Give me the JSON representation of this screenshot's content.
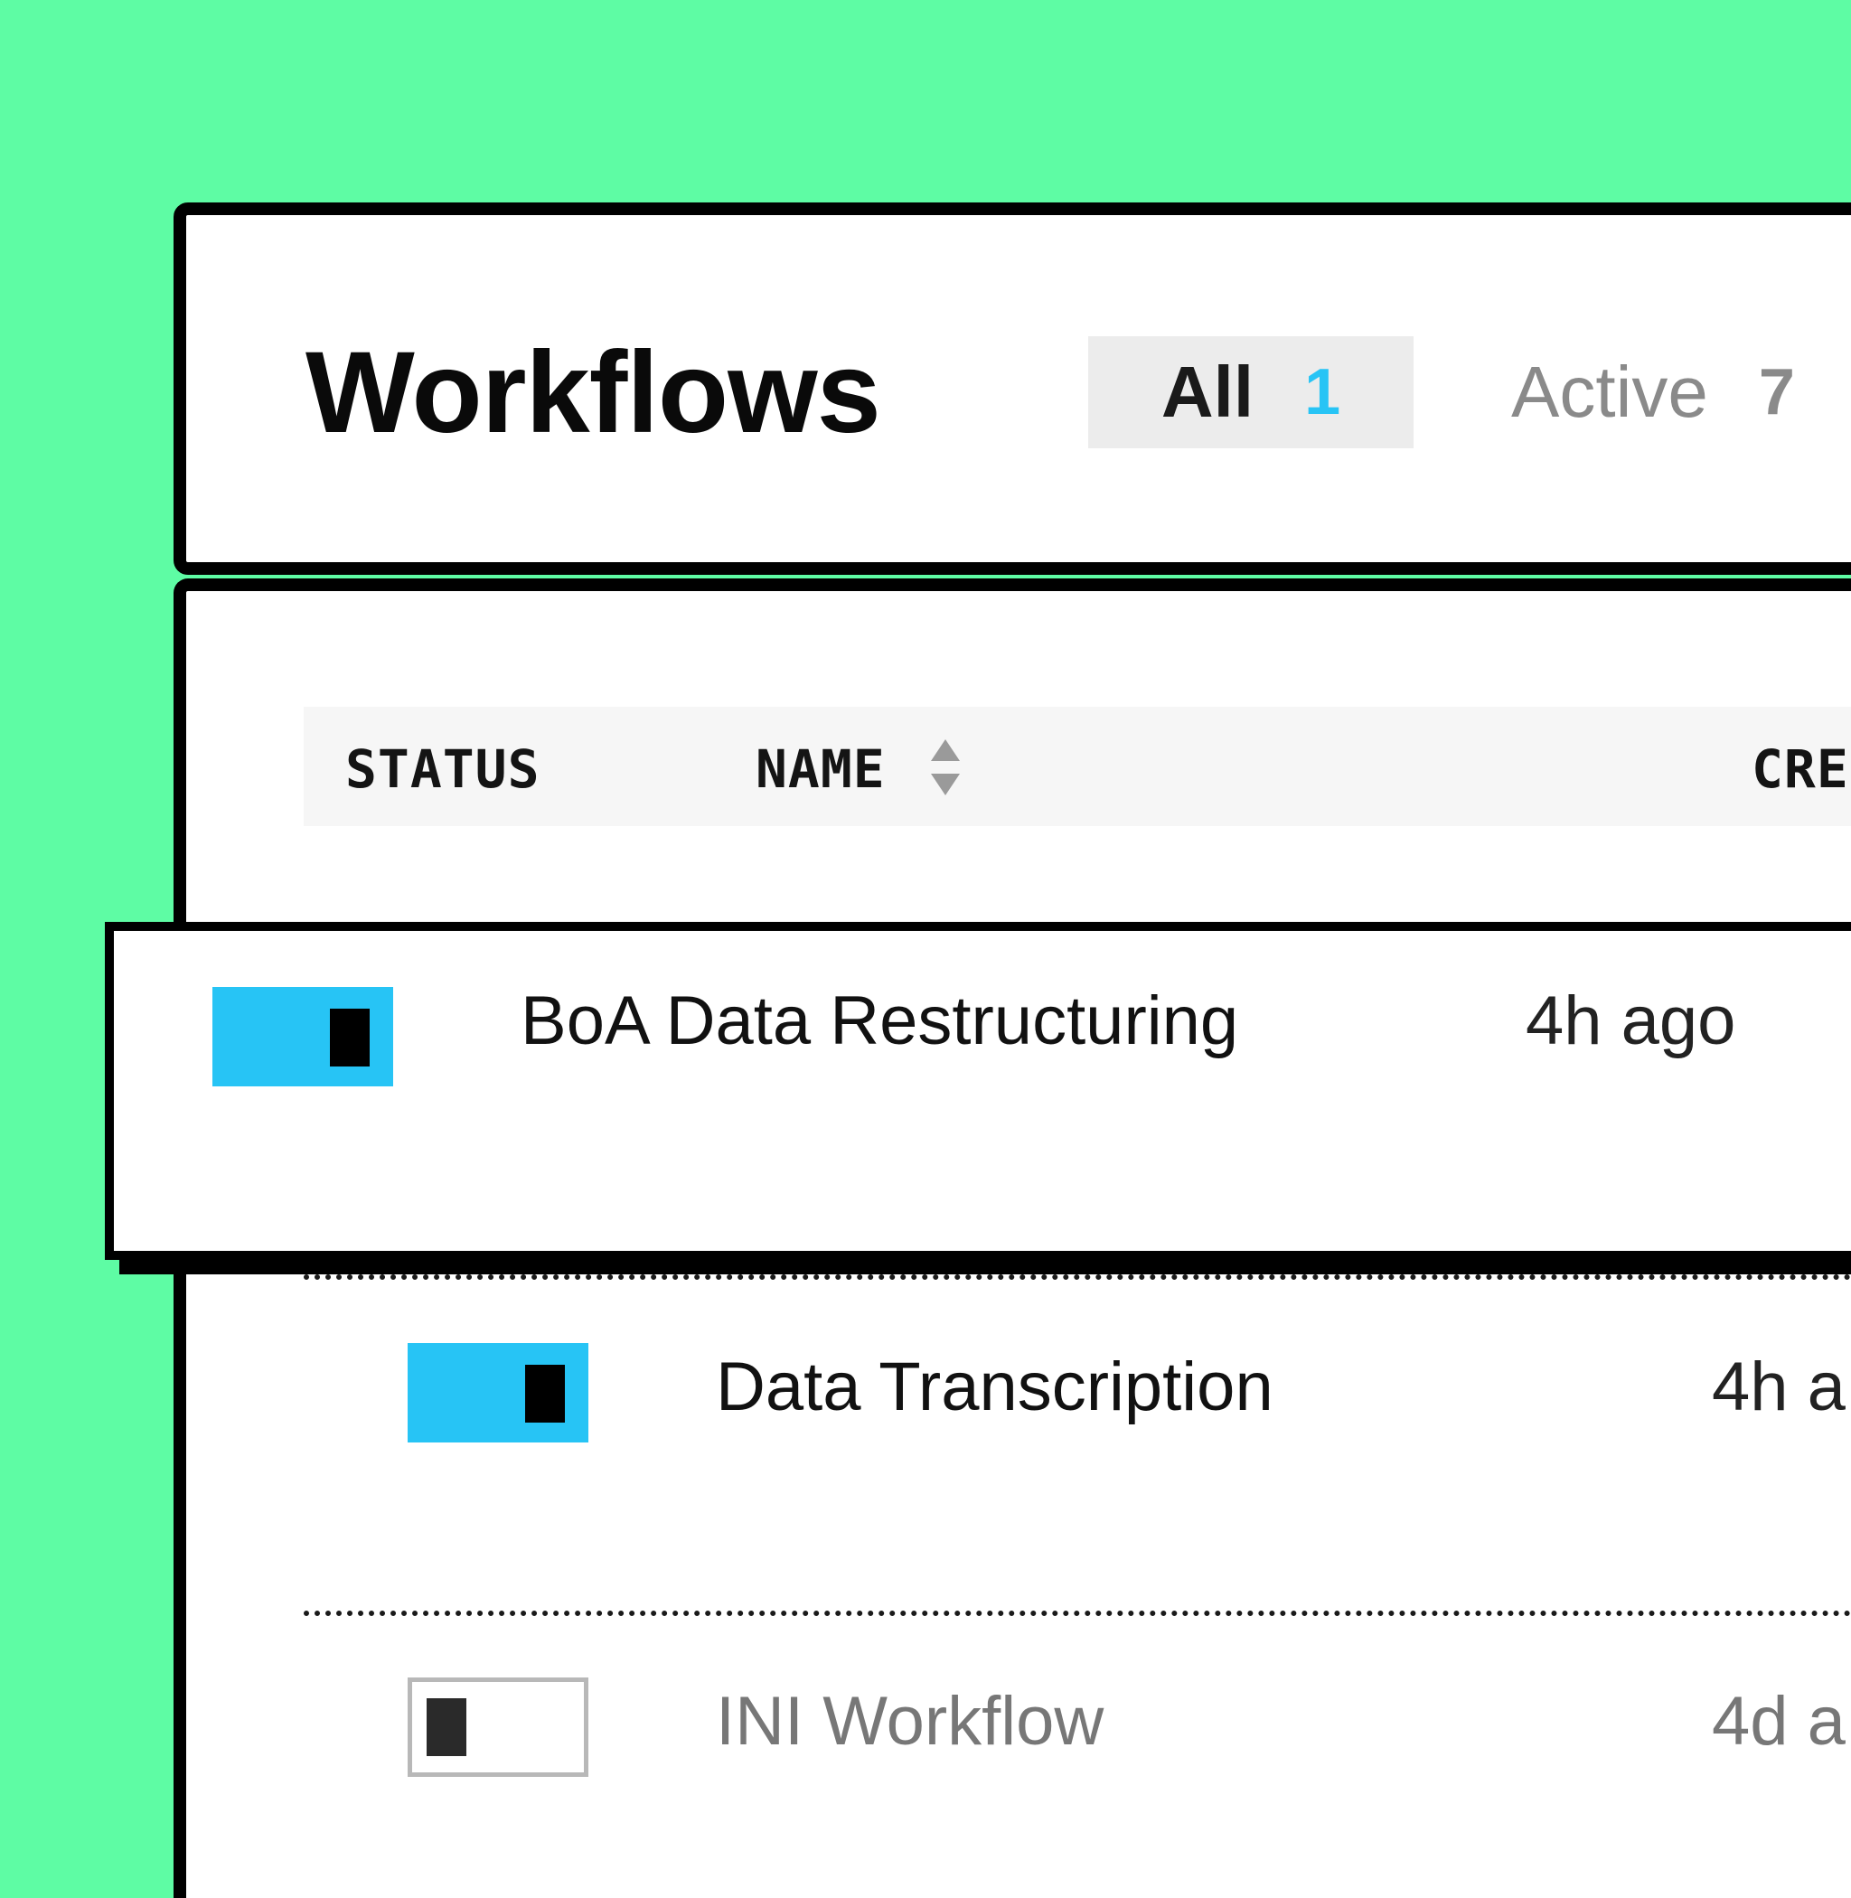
{
  "header": {
    "title": "Workflows",
    "tabs": [
      {
        "label": "All",
        "count": "1",
        "selected": true
      },
      {
        "label": "Active",
        "count": "7",
        "selected": false
      }
    ]
  },
  "table": {
    "columns": [
      "STATUS",
      "NAME",
      "CRE"
    ],
    "rows": [
      {
        "name": "BoA Data Restructuring",
        "created": "4h ago",
        "enabled": true,
        "hovered": true
      },
      {
        "name": "Data Transcription",
        "created": "4h a",
        "enabled": true,
        "hovered": false
      },
      {
        "name": "INI Workflow",
        "created": "4d a",
        "enabled": false,
        "hovered": false
      }
    ]
  },
  "colors": {
    "background": "#5efca4",
    "accent": "#27c4f5",
    "border": "#000000",
    "muted_text": "#777777"
  },
  "icons": {
    "sort": "sort-icon"
  }
}
